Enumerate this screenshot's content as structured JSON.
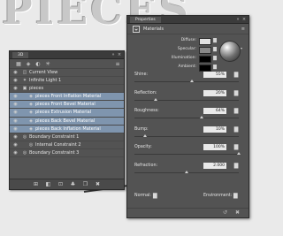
{
  "background": {
    "text": "PIECES"
  },
  "panel3d": {
    "tab_label": "3D",
    "tree": [
      {
        "label": "Current View",
        "icon": "camera-icon",
        "depth": 0,
        "selected": false
      },
      {
        "label": "Infinite Light 1",
        "icon": "light-icon",
        "depth": 0,
        "selected": false
      },
      {
        "label": "pieces",
        "icon": "mesh-icon",
        "depth": 0,
        "selected": false
      },
      {
        "label": "pieces Front Inflation Material",
        "icon": "material-icon",
        "depth": 1,
        "selected": true
      },
      {
        "label": "pieces Front Bevel Material",
        "icon": "material-icon",
        "depth": 1,
        "selected": true
      },
      {
        "label": "pieces Extrusion Material",
        "icon": "material-icon",
        "depth": 1,
        "selected": true
      },
      {
        "label": "pieces Back Bevel Material",
        "icon": "material-icon",
        "depth": 1,
        "selected": true
      },
      {
        "label": "pieces Back Inflation Material",
        "icon": "material-icon",
        "depth": 1,
        "selected": true
      },
      {
        "label": "Boundary Constraint 1",
        "icon": "constraint-icon",
        "depth": 0,
        "selected": false
      },
      {
        "label": "Internal Constraint 2",
        "icon": "constraint-icon",
        "depth": 1,
        "selected": false
      },
      {
        "label": "Boundary Constraint 3",
        "icon": "constraint-icon",
        "depth": 0,
        "selected": false
      }
    ]
  },
  "properties": {
    "tab_label": "Properties",
    "section_title": "Materials",
    "swatches": [
      {
        "label": "Diffuse:",
        "color": "#e3e3e3"
      },
      {
        "label": "Specular:",
        "color": "#8a8a8a"
      },
      {
        "label": "Illumination:",
        "color": "#000000"
      },
      {
        "label": "Ambient:",
        "color": "#000000"
      }
    ],
    "props": [
      {
        "label": "Shine:",
        "value": "55%",
        "fraction": 0.55
      },
      {
        "label": "Reflection:",
        "value": "20%",
        "fraction": 0.2
      },
      {
        "label": "Roughness:",
        "value": "64%",
        "fraction": 0.64
      },
      {
        "label": "Bump:",
        "value": "10%",
        "fraction": 0.1
      },
      {
        "label": "Opacity:",
        "value": "100%",
        "fraction": 1.0
      },
      {
        "label": "Refraction:",
        "value": "2.000",
        "fraction": 0.5
      }
    ],
    "normal_label": "Normal:",
    "environment_label": "Environment:"
  }
}
